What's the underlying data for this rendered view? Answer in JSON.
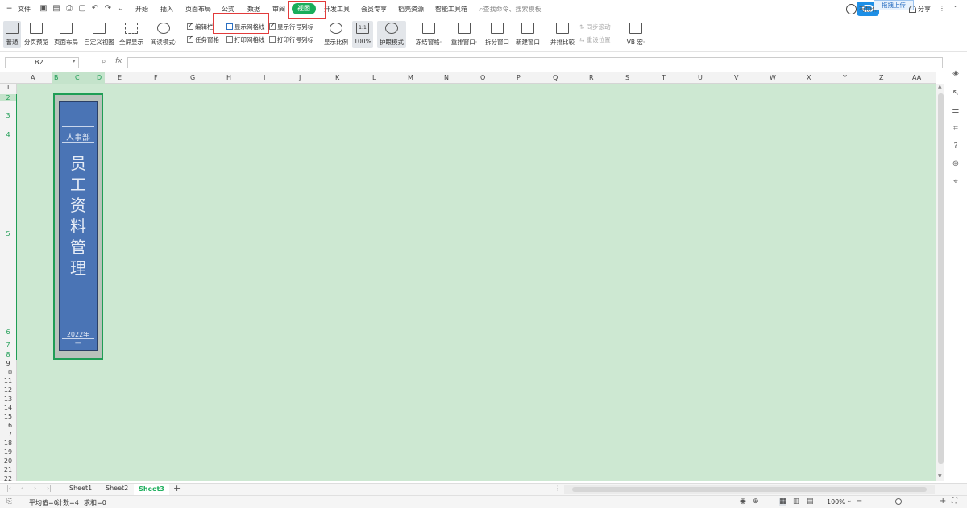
{
  "menubar": {
    "file_label": "文件",
    "tabs": [
      "开始",
      "插入",
      "页面布局",
      "公式",
      "数据",
      "审阅",
      "视图",
      "开发工具",
      "会员专享",
      "稻壳资源",
      "智能工具箱"
    ],
    "active_tab": "视图",
    "search_placeholder": "查找命令、搜索模板",
    "upload_label": "拖拽上传",
    "collab_label": "有协作",
    "share_label": "分享"
  },
  "ribbon": {
    "buttons": [
      "普通",
      "分页预览",
      "页面布局",
      "自定义视图",
      "全屏显示",
      "阅读模式·"
    ],
    "checkboxes": {
      "edit_bar": "编辑栏",
      "task_pane": "任务窗格",
      "show_gridlines": "显示网格线",
      "print_gridlines": "打印网格线",
      "show_headers": "显示行号列标",
      "print_headers": "打印行号列标"
    },
    "zoom_buttons": [
      "显示比例",
      "100%",
      "护眼模式"
    ],
    "window_buttons": [
      "冻结窗格·",
      "重排窗口·",
      "拆分窗口",
      "新建窗口",
      "并排比较"
    ],
    "sync_scroll": "同步滚动",
    "reset_position": "重设位置",
    "macro_label": "VB 宏·",
    "one_to_one": "1:1"
  },
  "formula_bar": {
    "name_box": "B2",
    "fx_label": "fx",
    "formula_value": ""
  },
  "sheet": {
    "columns": [
      "A",
      "B",
      "C",
      "D",
      "E",
      "F",
      "G",
      "H",
      "I",
      "J",
      "K",
      "L",
      "M",
      "N",
      "O",
      "P",
      "Q",
      "R",
      "S",
      "T",
      "U",
      "V",
      "W",
      "X",
      "Y",
      "Z",
      "AA"
    ],
    "rows": [
      "1",
      "2",
      "3",
      "4",
      "5",
      "6",
      "7",
      "8",
      "9",
      "10",
      "11",
      "12",
      "13",
      "14",
      "15",
      "16",
      "17",
      "18",
      "19",
      "20",
      "21",
      "22"
    ],
    "selected_columns": [
      "B",
      "C",
      "D"
    ],
    "spine_label": {
      "department": "人事部",
      "title_chars": [
        "员",
        "工",
        "资",
        "料",
        "管",
        "理"
      ],
      "year": "2022年",
      "volume": "一"
    },
    "colors": {
      "grid_background": "#cde8d2",
      "spine_blue": "#4a74b5",
      "selection_green": "#1f9d55",
      "highlight_red": "#e23b3b",
      "active_tab_green": "#1aad5a"
    }
  },
  "tabs": {
    "sheets": [
      "Sheet1",
      "Sheet2",
      "Sheet3"
    ],
    "active": "Sheet3"
  },
  "statusbar": {
    "average": "平均值=0",
    "count": "计数=4",
    "sum": "求和=0",
    "zoom": "100%"
  }
}
